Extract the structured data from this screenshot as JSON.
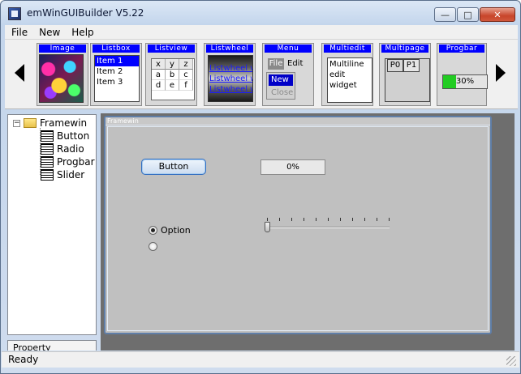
{
  "window": {
    "title": "emWinGUIBuilder V5.22",
    "min_glyph": "—",
    "max_glyph": "□",
    "close_glyph": "✕"
  },
  "menubar": {
    "items": [
      "File",
      "New",
      "Help"
    ]
  },
  "toolbar": {
    "tools": [
      {
        "label": "Image"
      },
      {
        "label": "Listbox",
        "items": [
          "Item 1",
          "Item 2",
          "Item 3"
        ],
        "selected": 0
      },
      {
        "label": "Listview",
        "header": [
          "x",
          "y",
          "z"
        ],
        "rows": [
          [
            "a",
            "b",
            "c"
          ],
          [
            "d",
            "e",
            "f"
          ]
        ]
      },
      {
        "label": "Listwheel",
        "items": [
          "Listwheel wid",
          "Listwheel wid",
          "Listwheel wid"
        ]
      },
      {
        "label": "Menu",
        "top": [
          "File",
          "Edit"
        ],
        "dropdown": [
          "New",
          "Close"
        ]
      },
      {
        "label": "Multiedit",
        "lines": [
          "Multiline",
          "edit",
          "widget"
        ]
      },
      {
        "label": "Multipage",
        "tabs": [
          "P0",
          "P1"
        ]
      },
      {
        "label": "Progbar",
        "value_text": "30%",
        "value": 0.3
      }
    ]
  },
  "tree": {
    "root": "Framewin",
    "children": [
      "Button",
      "Radio",
      "Progbar",
      "Slider"
    ]
  },
  "property_tab": {
    "label": "Property"
  },
  "framewin": {
    "title": "Framewin",
    "button_label": "Button",
    "progbar_text": "0%",
    "radio_label": "Option",
    "slider_value": 0
  },
  "status": {
    "text": "Ready"
  },
  "colors": {
    "selection": "#0000ff",
    "progress": "#22cc22",
    "frame_border": "#5f7ea8"
  }
}
